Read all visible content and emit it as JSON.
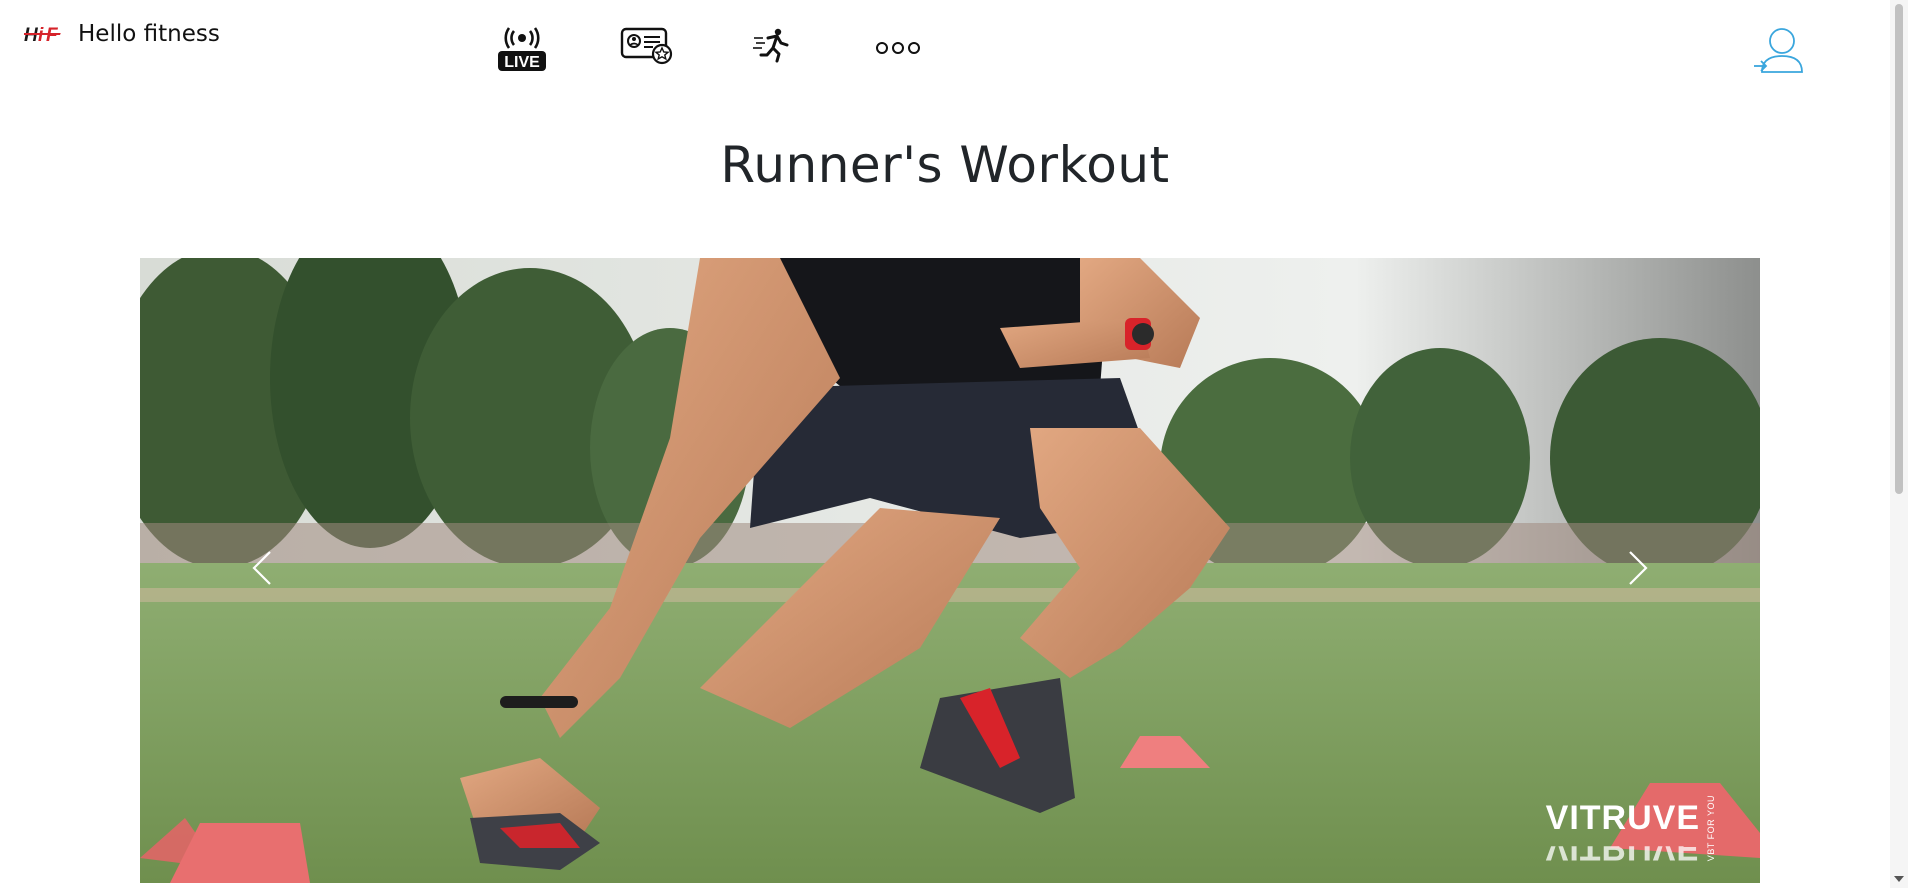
{
  "brand": {
    "logo_text": "HiF",
    "name": "Hello fitness"
  },
  "nav": {
    "items": [
      {
        "icon": "live-broadcast-icon",
        "label": "LIVE"
      },
      {
        "icon": "membership-card-icon"
      },
      {
        "icon": "running-person-icon"
      },
      {
        "icon": "more-dots-icon"
      }
    ]
  },
  "user": {
    "icon": "user-profile-icon",
    "accent_color": "#3aa6dd"
  },
  "page": {
    "title": "Runner's Workout"
  },
  "carousel": {
    "slide_description_icon": "workout-photo",
    "watermark": {
      "main": "VITRUVE",
      "side": "VBT FOR YOU"
    },
    "prev_icon": "chevron-left-icon",
    "next_icon": "chevron-right-icon"
  },
  "colors": {
    "brand_red": "#d6232a",
    "text": "#212529"
  }
}
